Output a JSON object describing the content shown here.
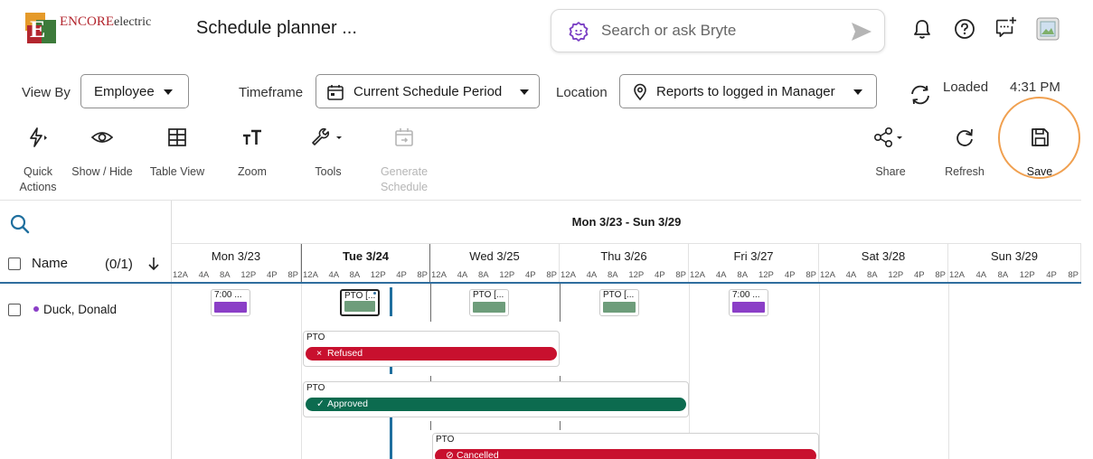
{
  "header": {
    "logo_letter": "E",
    "logo_brand": "ENCORE",
    "logo_sub": "electric",
    "page_title": "Schedule planner ...",
    "search_placeholder": "Search or ask Bryte"
  },
  "filters": {
    "view_by_label": "View By",
    "view_by_value": "Employee",
    "timeframe_label": "Timeframe",
    "timeframe_value": "Current Schedule Period",
    "location_label": "Location",
    "location_value": "Reports to logged in Manager",
    "loaded_label": "Loaded",
    "loaded_time": "4:31 PM"
  },
  "toolbar": {
    "quick_actions": "Quick Actions",
    "show_hide": "Show / Hide",
    "table_view": "Table View",
    "zoom": "Zoom",
    "tools": "Tools",
    "generate_schedule": "Generate Schedule",
    "share": "Share",
    "refresh": "Refresh",
    "save": "Save"
  },
  "grid": {
    "range_title": "Mon 3/23 - Sun 3/29",
    "name_header": "Name",
    "count_header": "(0/1)",
    "hour_labels": [
      "12A",
      "4A",
      "8A",
      "12P",
      "4P",
      "8P"
    ],
    "days": [
      {
        "label": "Mon 3/23"
      },
      {
        "label": "Tue 3/24"
      },
      {
        "label": "Wed 3/25"
      },
      {
        "label": "Thu 3/26"
      },
      {
        "label": "Fri 3/27"
      },
      {
        "label": "Sat 3/28"
      },
      {
        "label": "Sun 3/29"
      }
    ],
    "employee": {
      "name": "Duck, Donald"
    },
    "shifts": [
      {
        "day": "Mon",
        "label": "7:00 ...",
        "color": "#8b3fc7"
      },
      {
        "day": "Tue",
        "label": "PTO [...",
        "color": "#6e9d7b"
      },
      {
        "day": "Wed",
        "label": "PTO [...",
        "color": "#6e9d7b"
      },
      {
        "day": "Thu",
        "label": "PTO [...",
        "color": "#6e9d7b"
      },
      {
        "day": "Fri",
        "label": "7:00 ...",
        "color": "#8b3fc7"
      }
    ],
    "pto_requests": [
      {
        "label": "PTO",
        "status": "Refused",
        "mark": "×",
        "color": "#c8102e"
      },
      {
        "label": "PTO",
        "status": "Approved",
        "mark": "✓",
        "color": "#0c6b4f"
      },
      {
        "label": "PTO",
        "status": "Cancelled",
        "mark": "⊘",
        "color": "#c8102e"
      }
    ]
  },
  "colors": {
    "accent": "#1f6f9e",
    "save_highlight": "#f0a050",
    "bryte_purple": "#7a3fc4"
  }
}
